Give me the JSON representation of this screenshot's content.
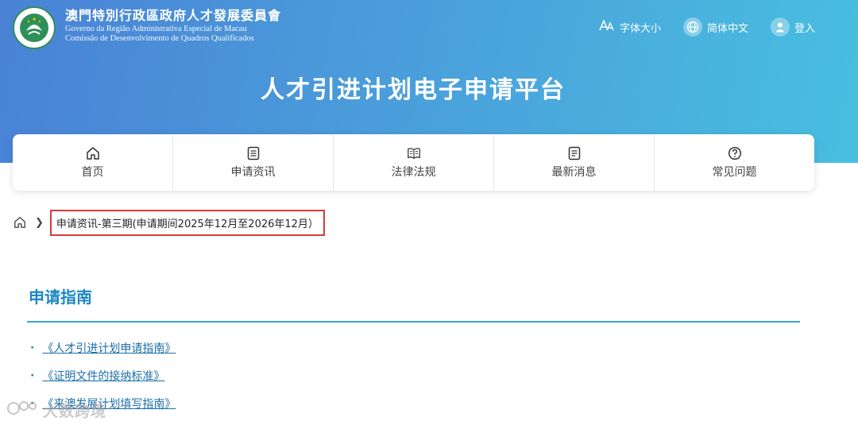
{
  "header": {
    "org_name_zh": "澳門特別行政區政府人才發展委員會",
    "org_name_pt_line1": "Governo da Região Administrativa Especial de Macau",
    "org_name_pt_line2": "Comissão de Desenvolvimento de Quadros Qualificados",
    "font_size_label": "字体大小",
    "language_label": "简体中文",
    "login_label": "登入"
  },
  "platform_title": "人才引进计划电子申请平台",
  "nav": {
    "items": [
      {
        "label": "首页",
        "icon": "home-icon"
      },
      {
        "label": "申请资讯",
        "icon": "document-icon"
      },
      {
        "label": "法律法规",
        "icon": "book-icon"
      },
      {
        "label": "最新消息",
        "icon": "news-icon"
      },
      {
        "label": "常见问题",
        "icon": "question-icon"
      }
    ]
  },
  "breadcrumb": {
    "current": "申请资讯-第三期(申请期间2025年12月至2026年12月）"
  },
  "guide": {
    "title": "申请指南",
    "links": [
      "《人才引进计划申请指南》",
      "《证明文件的接纳标准》",
      "《来澳发展计划填写指南》"
    ]
  },
  "watermark": "大数跨境",
  "colors": {
    "banner_start": "#4a82d6",
    "banner_end": "#48bfe0",
    "accent": "#1a86c5",
    "highlight_border": "#d63a3a"
  }
}
